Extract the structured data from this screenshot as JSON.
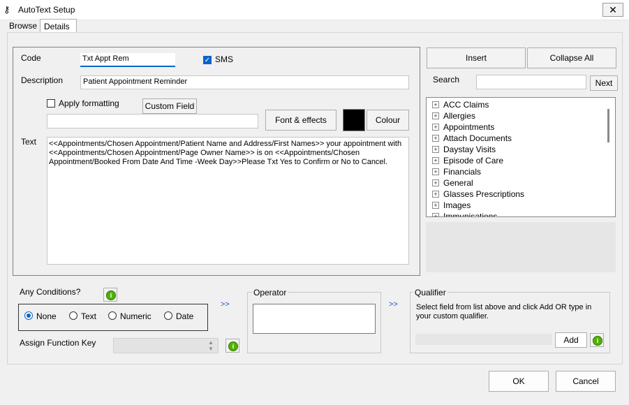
{
  "window": {
    "title": "AutoText Setup",
    "close_glyph": "✕"
  },
  "tabs": [
    {
      "label": "Browse"
    },
    {
      "label": "Details"
    }
  ],
  "form": {
    "code_label": "Code",
    "code_value": "Txt Appt Rem",
    "sms_label": "SMS",
    "sms_checked": true,
    "description_label": "Description",
    "description_value": "Patient Appointment Reminder",
    "apply_formatting_label": "Apply formatting",
    "custom_field_label": "Custom Field",
    "format_value": "",
    "font_effects_label": "Font & effects",
    "colour_label": "Colour",
    "colour_swatch": "#000000",
    "text_label": "Text",
    "text_value": "<<Appointments/Chosen Appointment/Patient Name and Address/First Names>> your appointment with <<Appointments/Chosen Appointment/Page Owner Name>> is on <<Appointments/Chosen Appointment/Booked From Date And Time -Week Day>>Please Txt Yes to Confirm or No to Cancel."
  },
  "right": {
    "insert_label": "Insert",
    "collapse_all_label": "Collapse All",
    "search_label": "Search",
    "search_value": "",
    "next_label": "Next",
    "tree": [
      {
        "label": "ACC Claims"
      },
      {
        "label": "Allergies"
      },
      {
        "label": "Appointments"
      },
      {
        "label": "Attach Documents"
      },
      {
        "label": "Daystay Visits"
      },
      {
        "label": "Episode of Care"
      },
      {
        "label": "Financials"
      },
      {
        "label": "General"
      },
      {
        "label": "Glasses Prescriptions"
      },
      {
        "label": "Images"
      },
      {
        "label": "Immunisations"
      }
    ]
  },
  "conditions": {
    "label": "Any Conditions?",
    "options": [
      {
        "label": "None",
        "selected": true
      },
      {
        "label": "Text"
      },
      {
        "label": "Numeric"
      },
      {
        "label": "Date"
      }
    ],
    "assign_function_key_label": "Assign Function Key"
  },
  "operator": {
    "label": "Operator",
    "arrows": ">>"
  },
  "qualifier": {
    "label": "Qualifier",
    "help": "Select field from list above and click Add OR type in your custom qualifier.",
    "add_label": "Add",
    "arrows": ">>"
  },
  "footer": {
    "ok_label": "OK",
    "cancel_label": "Cancel"
  }
}
